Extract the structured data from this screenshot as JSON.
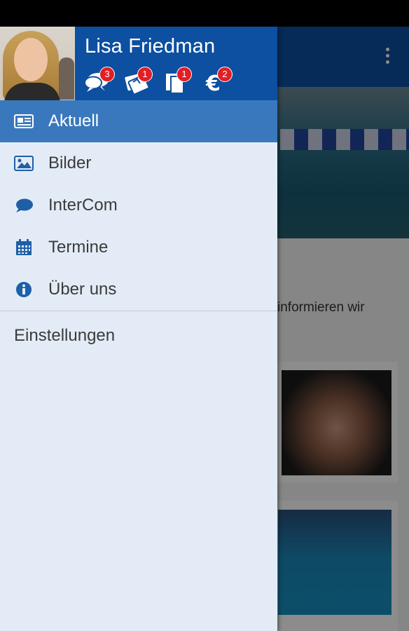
{
  "user": {
    "name": "Lisa Friedman"
  },
  "counters": [
    {
      "icon": "chat-bubbles-icon",
      "count": "3"
    },
    {
      "icon": "tickets-icon",
      "count": "1"
    },
    {
      "icon": "documents-icon",
      "count": "1"
    },
    {
      "icon": "euro-icon",
      "count": "2"
    }
  ],
  "menu": {
    "items": [
      {
        "icon": "newspaper-icon",
        "label": "Aktuell",
        "active": true
      },
      {
        "icon": "image-icon",
        "label": "Bilder",
        "active": false
      },
      {
        "icon": "chat-bubble-icon",
        "label": "InterCom",
        "active": false
      },
      {
        "icon": "calendar-icon",
        "label": "Termine",
        "active": false
      },
      {
        "icon": "info-icon",
        "label": "Über uns",
        "active": false
      }
    ],
    "settings_label": "Einstellungen"
  },
  "background": {
    "partial_text": "informieren wir"
  },
  "colors": {
    "primary": "#0d4fa0",
    "active_item": "#3a78bd",
    "drawer_bg": "#e3ecf6",
    "badge": "#e31e24",
    "icon_blue": "#1f5fa8"
  }
}
